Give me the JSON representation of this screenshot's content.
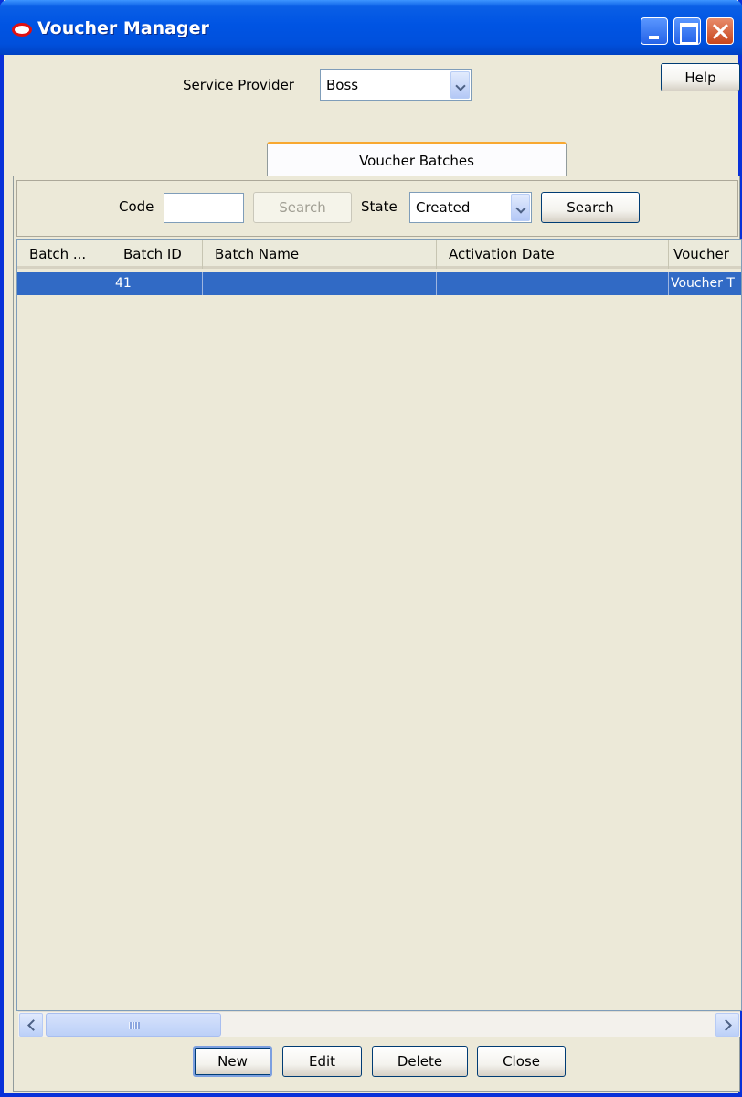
{
  "window": {
    "title": "Voucher Manager",
    "icon": "oracle-logo-icon",
    "controls": [
      "minimize-icon",
      "maximize-icon",
      "close-icon"
    ]
  },
  "header": {
    "service_provider_label": "Service Provider",
    "service_provider_value": "Boss",
    "help_label": "Help"
  },
  "tabs": [
    {
      "label": "Voucher Batches",
      "selected": true
    }
  ],
  "search": {
    "code_label": "Code",
    "code_value": "",
    "code_search_label": "Search",
    "state_label": "State",
    "state_value": "Created",
    "state_search_label": "Search"
  },
  "table": {
    "columns": [
      "Batch ...",
      "Batch ID",
      "Batch Name",
      "Activation Date",
      "Voucher"
    ],
    "rows": [
      [
        "",
        "41",
        "",
        "",
        "Voucher T"
      ]
    ]
  },
  "scrollbar": {
    "grip": "III"
  },
  "footer": {
    "new_label": "New",
    "edit_label": "Edit",
    "delete_label": "Delete",
    "close_label": "Close"
  },
  "colors": {
    "titlebar": "#0054e3",
    "selection": "#316ac5",
    "tab_accent": "#f8a830",
    "background": "#ece9d8"
  }
}
